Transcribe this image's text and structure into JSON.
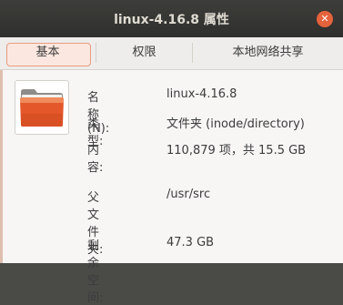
{
  "window": {
    "title": "linux-4.16.8 属性"
  },
  "tabs": [
    {
      "label": "基本",
      "active": true
    },
    {
      "label": "权限",
      "active": false
    },
    {
      "label": "本地网络共享",
      "active": false
    }
  ],
  "properties": {
    "name_label": "名称(N):",
    "name_value": "linux-4.16.8",
    "type_label": "类型:",
    "type_value": "文件夹 (inode/directory)",
    "contents_label": "内容:",
    "contents_value": "110,879 项，共 15.5 GB",
    "parent_label": "父文件夹:",
    "parent_value": "/usr/src",
    "free_label": "剩余空间:",
    "free_value": "47.3 GB"
  },
  "colors": {
    "accent": "#e95420",
    "titlebar": "#323230"
  },
  "icons": {
    "close": "close-icon",
    "folder": "folder-icon"
  }
}
